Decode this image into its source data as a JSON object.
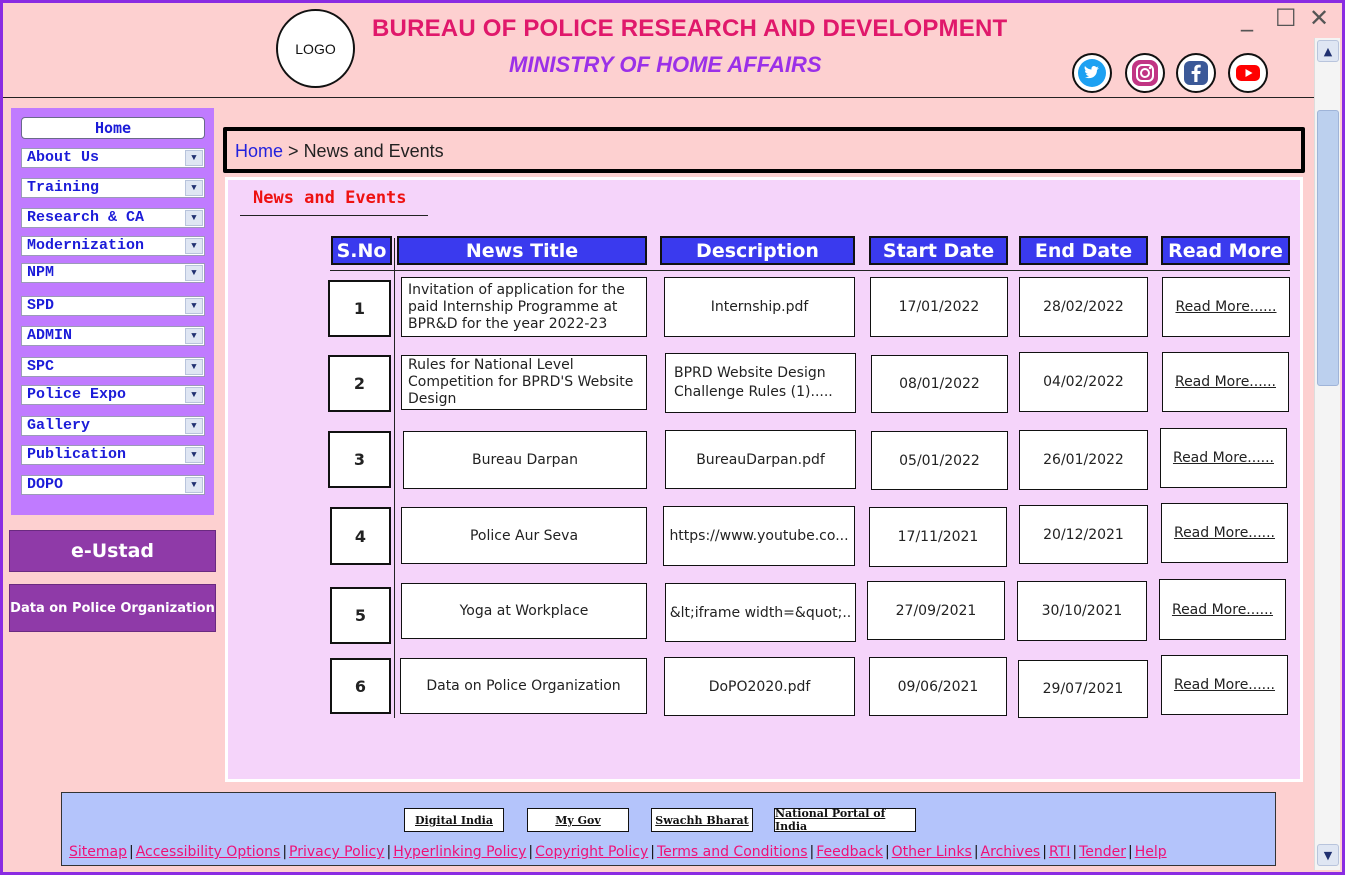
{
  "header": {
    "logo_text": "LOGO",
    "title": "BUREAU OF POLICE RESEARCH AND DEVELOPMENT",
    "subtitle": "MINISTRY OF HOME AFFAIRS",
    "window_minimize": "_",
    "window_maximize": "☐",
    "window_close": "✕",
    "social_icons": [
      "twitter-icon",
      "instagram-icon",
      "facebook-icon",
      "youtube-icon"
    ]
  },
  "sidebar": {
    "home_label": "Home",
    "items": [
      "About Us",
      "Training",
      "Research & CA",
      "Modernization",
      "NPM",
      "SPD",
      "ADMIN",
      "SPC",
      "Police Expo",
      "Gallery",
      "Publication",
      "DOPO"
    ],
    "eustad_label": "e-Ustad",
    "dopo_label": "Data on Police Organization"
  },
  "breadcrumb": {
    "home": "Home",
    "separator": ">",
    "current": "News and Events"
  },
  "main": {
    "section_title": "News and Events",
    "table": {
      "headers": [
        "S.No",
        "News Title",
        "Description",
        "Start Date",
        "End Date",
        "Read More"
      ],
      "rows": [
        {
          "sno": "1",
          "title": "Invitation of application for the paid Internship Programme at BPR&D for the year 2022-23",
          "description": "Internship.pdf",
          "start": "17/01/2022",
          "end": "28/02/2022",
          "more": "Read More......"
        },
        {
          "sno": "2",
          "title": "Rules for National Level Competition for BPRD'S Website Design",
          "description": "BPRD Website Design Challenge Rules (1).....",
          "start": "08/01/2022",
          "end": "04/02/2022",
          "more": "Read More......"
        },
        {
          "sno": "3",
          "title": "Bureau Darpan",
          "description": "BureauDarpan.pdf",
          "start": "05/01/2022",
          "end": "26/01/2022",
          "more": "Read More......"
        },
        {
          "sno": "4",
          "title": "Police Aur Seva",
          "description": "https://www.youtube.co...",
          "start": "17/11/2021",
          "end": "20/12/2021",
          "more": "Read More......"
        },
        {
          "sno": "5",
          "title": "Yoga at Workplace",
          "description": "&lt;iframe width=&quot;..",
          "start": "27/09/2021",
          "end": "30/10/2021",
          "more": "Read More......"
        },
        {
          "sno": "6",
          "title": "Data on Police Organization",
          "description": "DoPO2020.pdf",
          "start": "09/06/2021",
          "end": "29/07/2021",
          "more": "Read More......"
        }
      ]
    }
  },
  "footer": {
    "buttons": [
      "Digital India",
      "My Gov",
      "Swachh Bharat",
      "National Portal of India"
    ],
    "links": [
      "Sitemap",
      "Accessibility Options",
      "Privacy Policy",
      "Hyperlinking Policy",
      "Copyright Policy",
      "Terms and Conditions",
      "Feedback",
      "Other Links",
      "Archives",
      "RTI",
      "Tender",
      "Help"
    ]
  },
  "colors": {
    "background": "#fdd0d0",
    "title": "#e0186b",
    "subtitle": "#9b30e8",
    "sidebar": "#c07bff",
    "header_cell": "#3a3aee",
    "panel": "#f5d4fa",
    "footer": "#b4c4fb",
    "link": "#ee1177"
  }
}
